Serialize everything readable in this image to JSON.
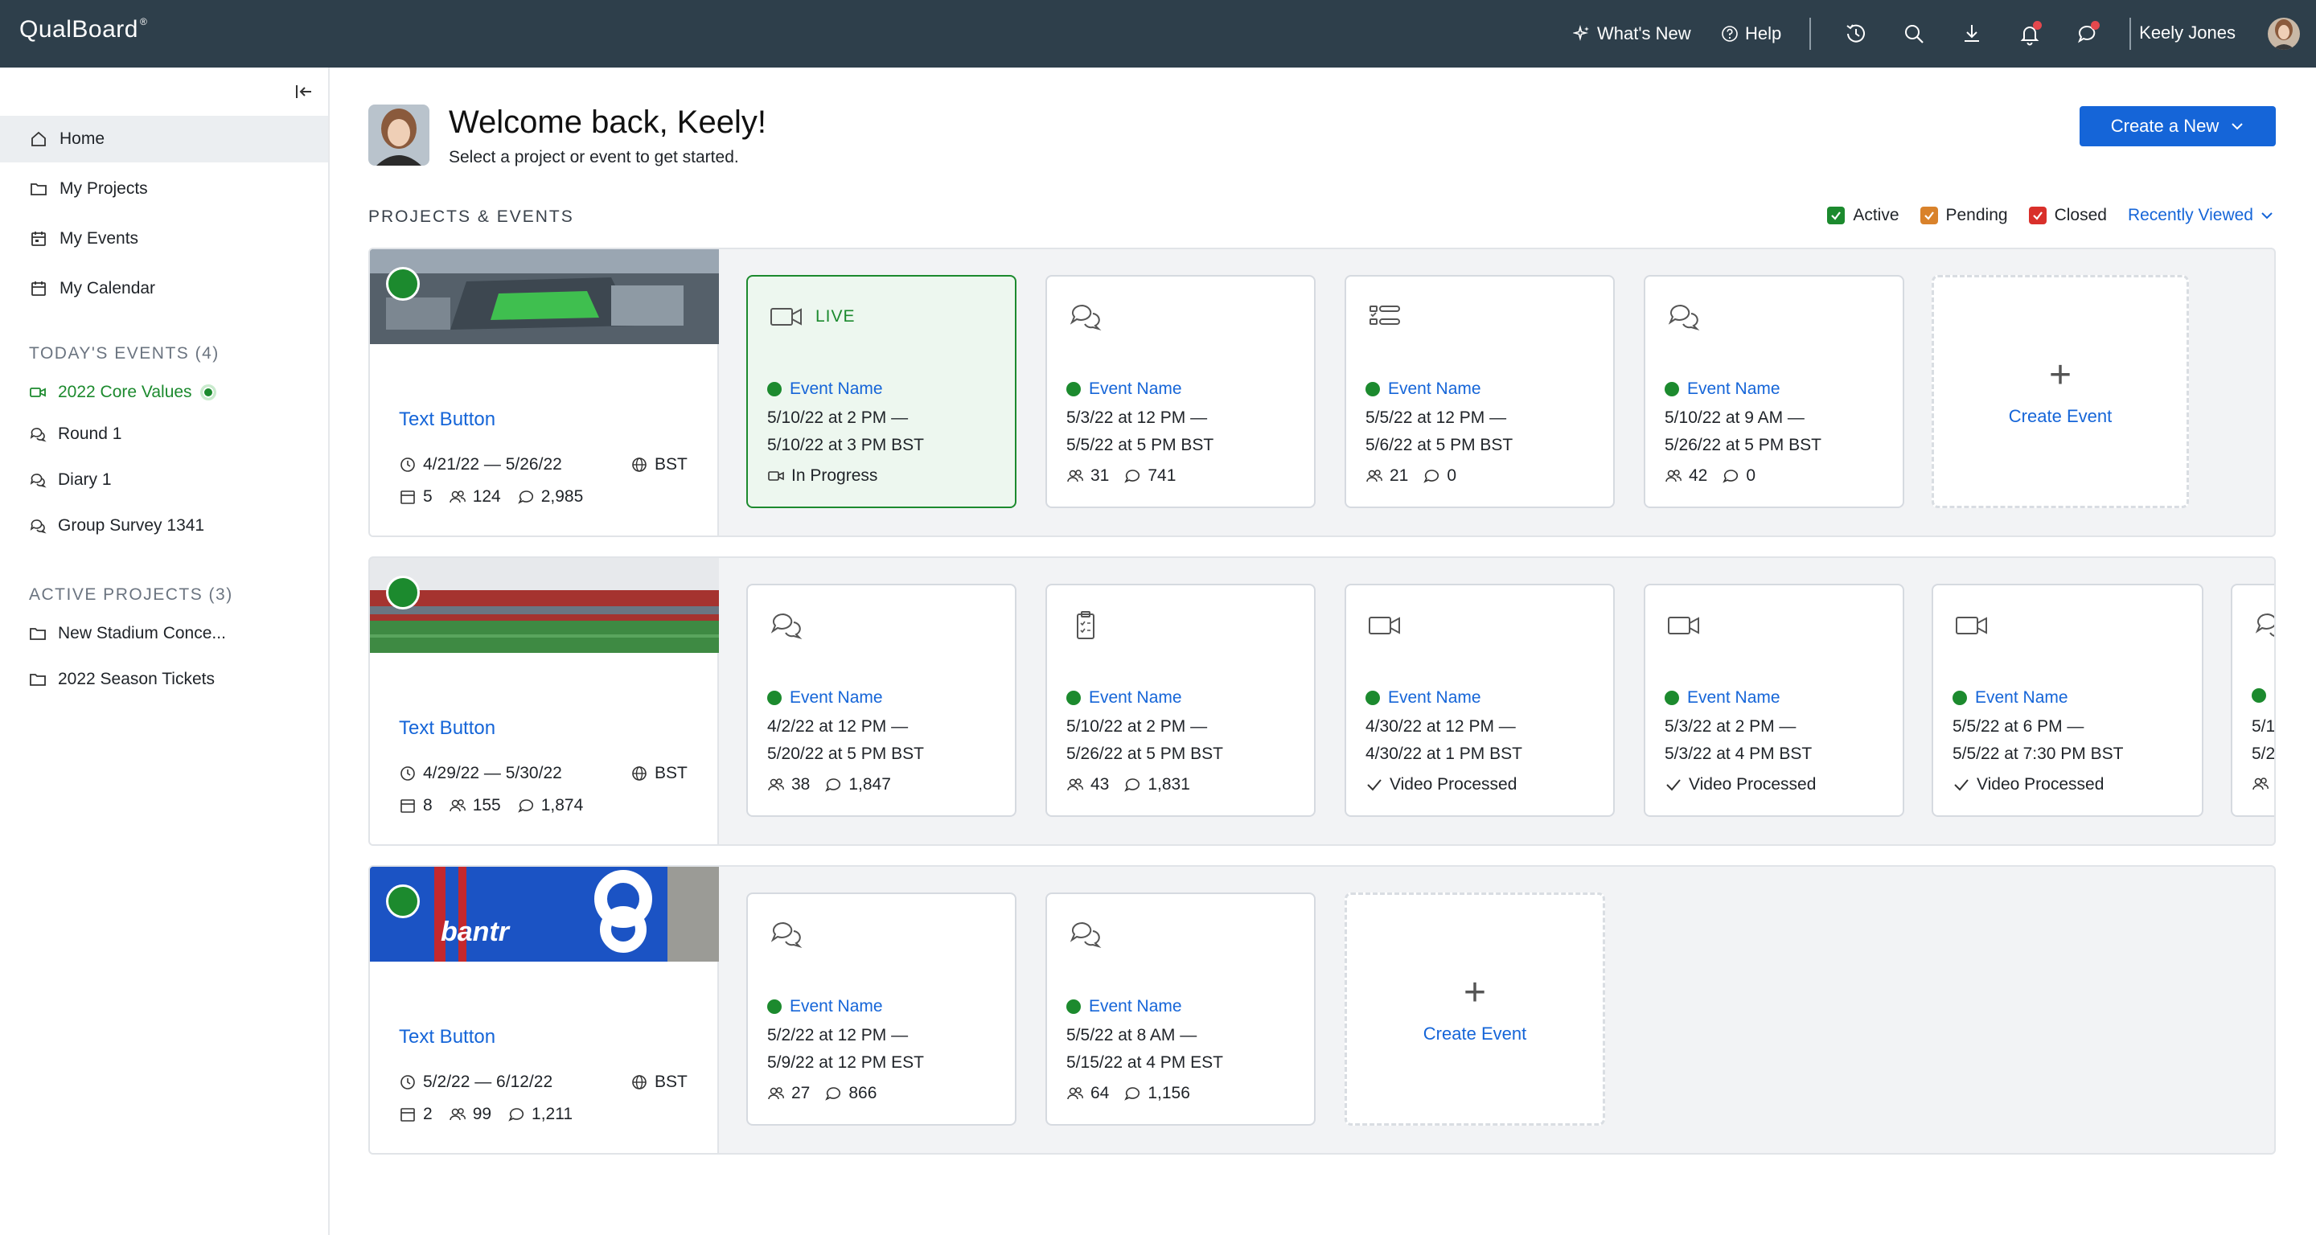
{
  "app": {
    "logo": "QualBoard",
    "logo_mark": "®"
  },
  "topbar": {
    "whats_new": "What's New",
    "help": "Help",
    "user_name": "Keely Jones"
  },
  "sidebar": {
    "nav": [
      {
        "label": "Home"
      },
      {
        "label": "My Projects"
      },
      {
        "label": "My Events"
      },
      {
        "label": "My Calendar"
      }
    ],
    "todays_events_head": "TODAY'S EVENTS (4)",
    "todays_events": [
      {
        "label": "2022 Core Values"
      },
      {
        "label": "Round 1"
      },
      {
        "label": "Diary 1"
      },
      {
        "label": "Group Survey 1341"
      }
    ],
    "active_projects_head": "ACTIVE PROJECTS (3)",
    "active_projects": [
      {
        "label": "New Stadium Conce..."
      },
      {
        "label": "2022 Season Tickets"
      }
    ]
  },
  "main": {
    "welcome_title": "Welcome back, Keely!",
    "welcome_sub": "Select a project or event to get started.",
    "create_new": "Create a New",
    "section_head": "PROJECTS & EVENTS",
    "filters": {
      "active": "Active",
      "pending": "Pending",
      "closed": "Closed",
      "sort": "Recently Viewed"
    },
    "filter_colors": {
      "active": "#1c8a2e",
      "pending": "#d9822b",
      "closed": "#d9302b"
    },
    "projects": [
      {
        "link": "Text Button",
        "dates": "4/21/22 — 5/26/22",
        "tz": "BST",
        "events": "5",
        "people": "124",
        "comments": "2,985",
        "cards": [
          {
            "live": true,
            "live_label": "LIVE",
            "icon": "video-icon",
            "name": "Event Name",
            "l1": "5/10/22 at 2 PM —",
            "l2": "5/10/22 at 3 PM BST",
            "status": "In Progress"
          },
          {
            "icon": "chat-icon",
            "name": "Event Name",
            "l1": "5/3/22 at 12 PM —",
            "l2": "5/5/22 at 5 PM BST",
            "people": "31",
            "comments": "741"
          },
          {
            "icon": "survey-icon",
            "name": "Event Name",
            "l1": "5/5/22 at 12 PM —",
            "l2": "5/6/22 at 5 PM BST",
            "people": "21",
            "comments": "0"
          },
          {
            "icon": "chat-icon",
            "name": "Event Name",
            "l1": "5/10/22 at 9 AM —",
            "l2": "5/26/22 at 5 PM BST",
            "people": "42",
            "comments": "0"
          }
        ],
        "create_label": "Create Event"
      },
      {
        "link": "Text Button",
        "dates": "4/29/22 — 5/30/22",
        "tz": "BST",
        "events": "8",
        "people": "155",
        "comments": "1,874",
        "cards": [
          {
            "icon": "chat-icon",
            "name": "Event Name",
            "l1": "4/2/22 at 12 PM —",
            "l2": "5/20/22 at 5 PM BST",
            "people": "38",
            "comments": "1,847"
          },
          {
            "icon": "clipboard-icon",
            "name": "Event Name",
            "l1": "5/10/22 at 2 PM —",
            "l2": "5/26/22 at 5 PM BST",
            "people": "43",
            "comments": "1,831"
          },
          {
            "icon": "video-icon",
            "name": "Event Name",
            "l1": "4/30/22 at 12 PM —",
            "l2": "4/30/22 at 1 PM BST",
            "status": "Video Processed"
          },
          {
            "icon": "video-icon",
            "name": "Event Name",
            "l1": "5/3/22 at 2 PM —",
            "l2": "5/3/22 at 4 PM BST",
            "status": "Video Processed"
          },
          {
            "icon": "video-icon",
            "name": "Event Name",
            "l1": "5/5/22 at 6 PM —",
            "l2": "5/5/22 at 7:30 PM BST",
            "status": "Video Processed"
          },
          {
            "icon": "chat-icon",
            "name": "",
            "l1": "5/1",
            "l2": "5/2",
            "people": ""
          }
        ]
      },
      {
        "link": "Text Button",
        "dates": "5/2/22 — 6/12/22",
        "tz": "BST",
        "events": "2",
        "people": "99",
        "comments": "1,211",
        "cards": [
          {
            "icon": "chat-icon",
            "name": "Event Name",
            "l1": "5/2/22 at 12 PM —",
            "l2": "5/9/22 at 12 PM EST",
            "people": "27",
            "comments": "866"
          },
          {
            "icon": "chat-icon",
            "name": "Event Name",
            "l1": "5/5/22 at 8 AM —",
            "l2": "5/15/22 at 4 PM EST",
            "people": "64",
            "comments": "1,156"
          }
        ],
        "create_label": "Create Event"
      }
    ]
  }
}
